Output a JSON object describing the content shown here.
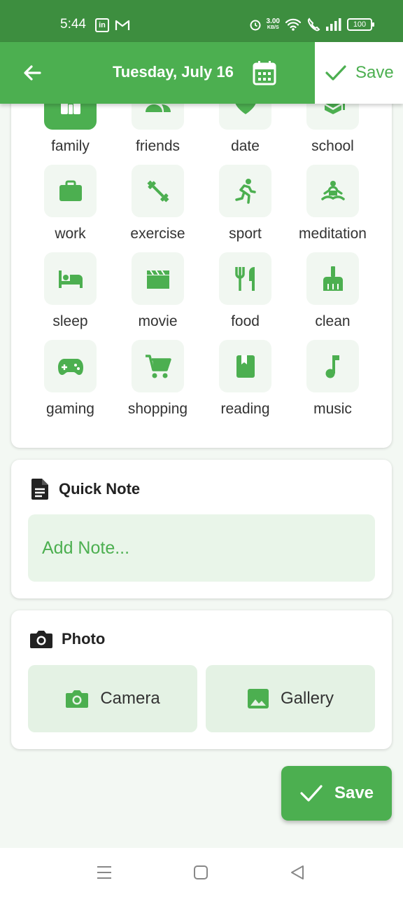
{
  "status_bar": {
    "time": "5:44",
    "speed_value": "3.00",
    "speed_unit": "KB/S",
    "battery": "100"
  },
  "app_bar": {
    "title": "Tuesday, July 16",
    "save_label": "Save"
  },
  "activities": [
    {
      "label": "family",
      "icon": "family-icon",
      "selected": true
    },
    {
      "label": "friends",
      "icon": "friends-icon",
      "selected": false
    },
    {
      "label": "date",
      "icon": "heart-icon",
      "selected": false
    },
    {
      "label": "school",
      "icon": "school-icon",
      "selected": false
    },
    {
      "label": "work",
      "icon": "briefcase-icon",
      "selected": false
    },
    {
      "label": "exercise",
      "icon": "dumbbell-icon",
      "selected": false
    },
    {
      "label": "sport",
      "icon": "running-icon",
      "selected": false
    },
    {
      "label": "meditation",
      "icon": "meditation-icon",
      "selected": false
    },
    {
      "label": "sleep",
      "icon": "bed-icon",
      "selected": false
    },
    {
      "label": "movie",
      "icon": "clapperboard-icon",
      "selected": false
    },
    {
      "label": "food",
      "icon": "restaurant-icon",
      "selected": false
    },
    {
      "label": "clean",
      "icon": "broom-icon",
      "selected": false
    },
    {
      "label": "gaming",
      "icon": "gamepad-icon",
      "selected": false
    },
    {
      "label": "shopping",
      "icon": "cart-icon",
      "selected": false
    },
    {
      "label": "reading",
      "icon": "book-icon",
      "selected": false
    },
    {
      "label": "music",
      "icon": "music-note-icon",
      "selected": false
    }
  ],
  "quick_note": {
    "title": "Quick Note",
    "placeholder": "Add Note..."
  },
  "photo": {
    "title": "Photo",
    "camera_label": "Camera",
    "gallery_label": "Gallery"
  },
  "fab": {
    "save_label": "Save"
  },
  "colors": {
    "primary": "#4caf50",
    "status_bar": "#3d8e3f",
    "tile_bg": "#f1f7f1",
    "input_bg": "#e9f5e9"
  }
}
